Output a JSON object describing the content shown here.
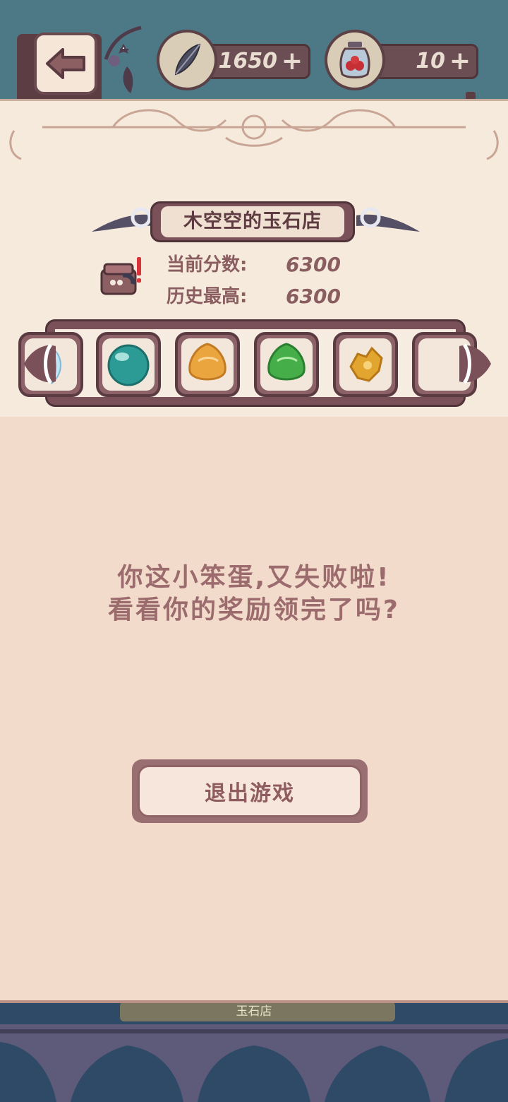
{
  "top_bar": {
    "feather": {
      "value": "1650",
      "plus": "+"
    },
    "jar": {
      "value": "10",
      "plus": "+"
    }
  },
  "shop": {
    "title": "木空空的玉石店"
  },
  "scores": {
    "current_label": "当前分数:",
    "current_value": "6300",
    "best_label": "历史最高:",
    "best_value": "6300"
  },
  "gems": [
    "crescent-gem",
    "teal-orb-gem",
    "amber-drop-gem",
    "green-drop-gem",
    "gold-nugget-gem",
    "empty-slot"
  ],
  "colors": {
    "teal": "#3aa3a0",
    "amber": "#e8a23e",
    "green": "#46b24a",
    "gold": "#e2a530"
  },
  "dialog": {
    "line1": "你这小笨蛋,又失败啦!",
    "line2": "看看你的奖励领完了吗?",
    "exit_label": "退出游戏"
  },
  "background": {
    "shop_sign": "玉石店"
  }
}
